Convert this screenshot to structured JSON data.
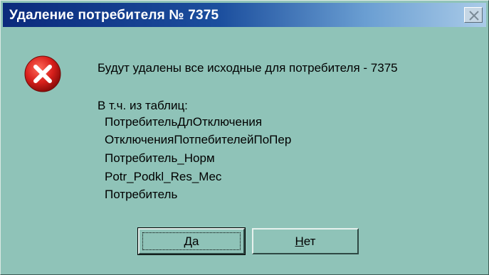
{
  "dialog": {
    "title": "Удаление потребителя № 7375",
    "icon": "error-icon",
    "message_line": "Будут удалены все исходные для потребителя - 7375",
    "tables_header": "В т.ч. из таблиц:",
    "tables": [
      "ПотребительДлОтключения",
      "ОтключенияПотпебителейПоПер",
      "Потребитель_Норм",
      "Potr_Podkl_Res_Mec",
      "Потребитель"
    ]
  },
  "buttons": {
    "yes_accel": "Д",
    "yes_rest": "а",
    "no_accel": "Н",
    "no_rest": "ет"
  },
  "colors": {
    "background": "#8fc3b8",
    "titlebar_start": "#0b2a7c",
    "titlebar_end": "#aacbe8",
    "error_red": "#d8201c"
  }
}
